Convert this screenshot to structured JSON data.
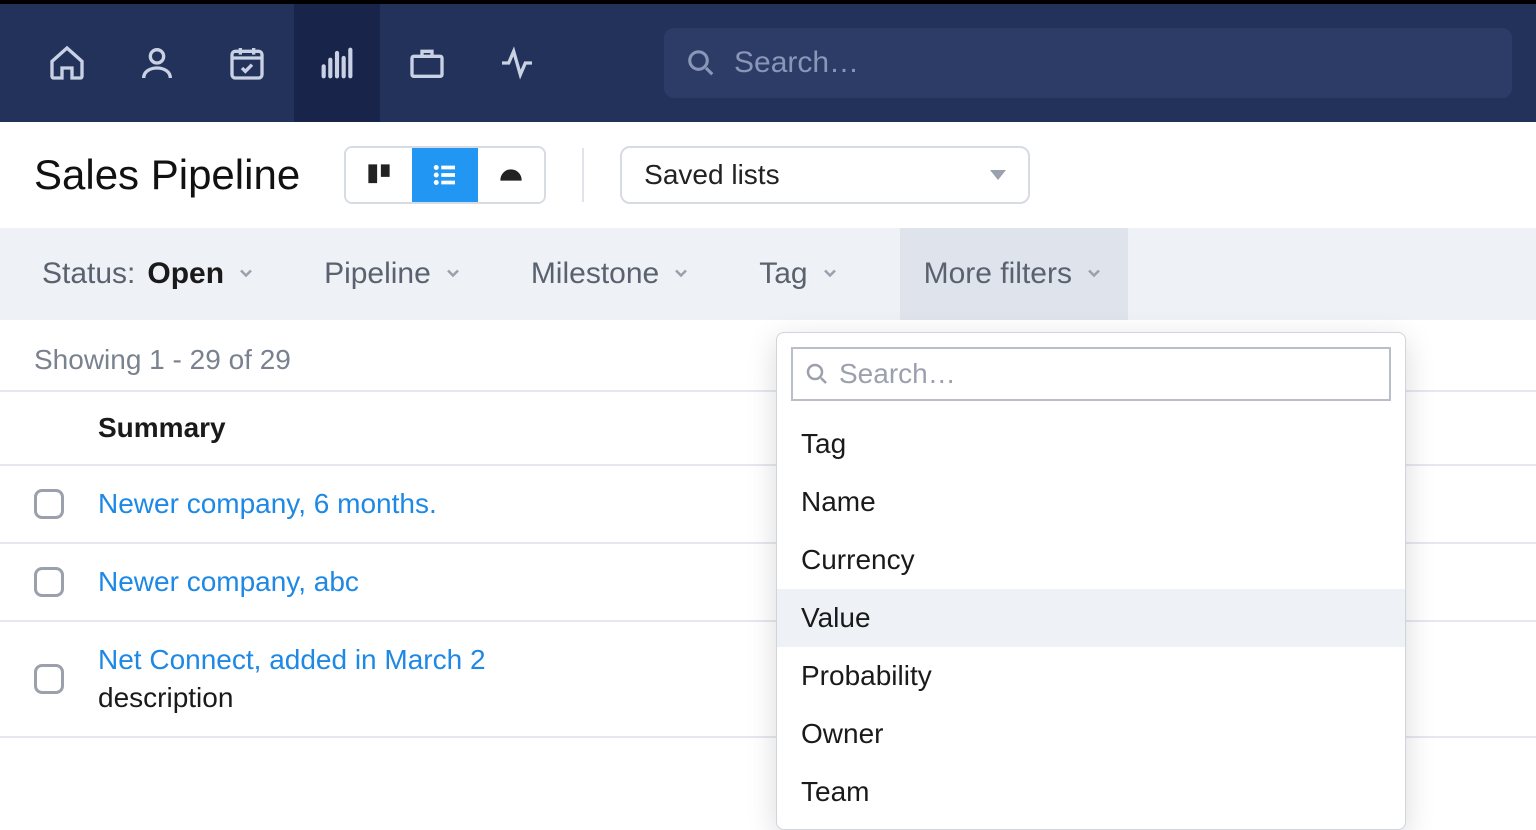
{
  "nav": {
    "search_placeholder": "Search…"
  },
  "header": {
    "title": "Sales Pipeline",
    "saved_lists_label": "Saved lists"
  },
  "filters": {
    "status_label": "Status:",
    "status_value": "Open",
    "pipeline": "Pipeline",
    "milestone": "Milestone",
    "tag": "Tag",
    "more": "More filters"
  },
  "showing": "Showing 1 - 29 of 29",
  "table": {
    "header_summary": "Summary",
    "rows": [
      {
        "title": "Newer company, 6 months.",
        "desc": ""
      },
      {
        "title": "Newer company, abc",
        "desc": ""
      },
      {
        "title": "Net Connect, added in March 2",
        "desc": "description"
      }
    ]
  },
  "popover": {
    "search_placeholder": "Search…",
    "items": [
      "Tag",
      "Name",
      "Currency",
      "Value",
      "Probability",
      "Owner",
      "Team"
    ],
    "hover_index": 3
  }
}
